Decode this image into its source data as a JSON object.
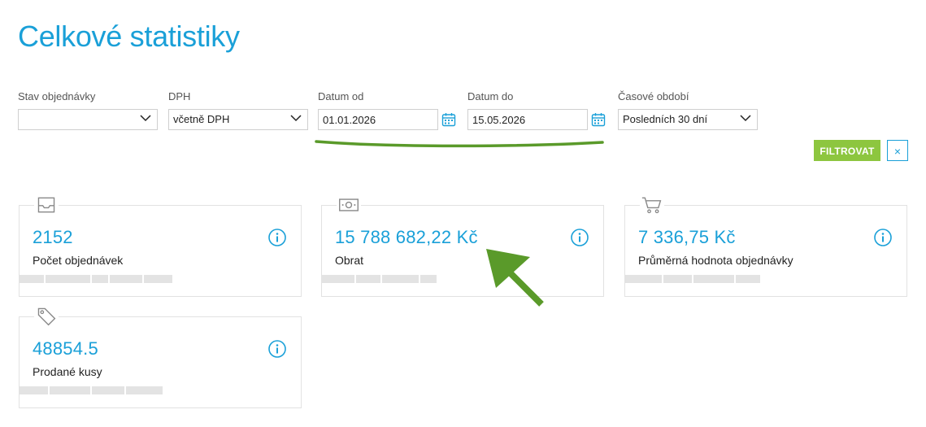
{
  "page": {
    "title": "Celkové statistiky"
  },
  "filters": {
    "order_status": {
      "label": "Stav objednávky",
      "value": ""
    },
    "vat": {
      "label": "DPH",
      "value": "včetně DPH"
    },
    "date_from": {
      "label": "Datum od",
      "value": "01.01.2026"
    },
    "date_to": {
      "label": "Datum do",
      "value": "15.05.2026"
    },
    "period": {
      "label": "Časové období",
      "value": "Posledních 30 dní"
    },
    "filter_button": "FILTROVAT",
    "reset_button": "×"
  },
  "cards": [
    {
      "icon": "inbox-tray-icon",
      "value": "2152",
      "label": "Počet objednávek"
    },
    {
      "icon": "banknote-icon",
      "value": "15 788 682,22 Kč",
      "label": "Obrat"
    },
    {
      "icon": "shopping-cart-icon",
      "value": "7 336,75 Kč",
      "label": "Průměrná hodnota objednávky"
    },
    {
      "icon": "price-tag-icon",
      "value": "48854.5",
      "label": "Prodané kusy"
    }
  ],
  "colors": {
    "accent": "#1aa0d8",
    "button_green": "#8dc63f",
    "annotation_green": "#5a9a2a"
  }
}
